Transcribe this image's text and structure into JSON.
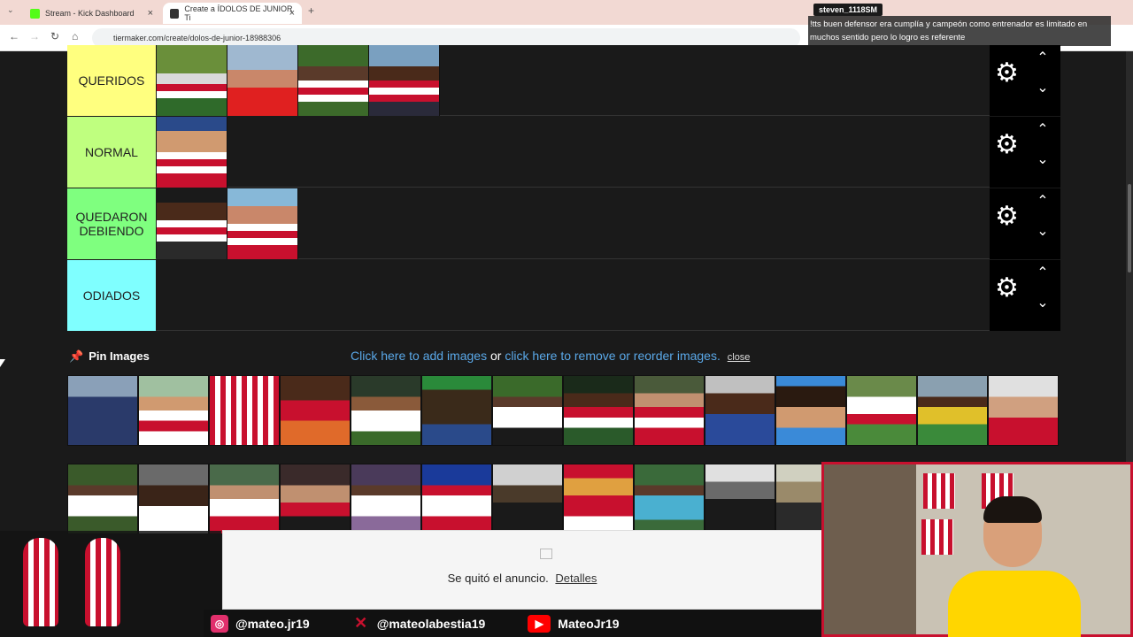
{
  "browser": {
    "tabs": [
      {
        "title": "Stream - Kick Dashboard",
        "favicon_color": "#53fc18"
      },
      {
        "title": "Create a ÍDOLOS DE JUNIOR Ti",
        "favicon_color": "#333333"
      }
    ],
    "new_tab": "+",
    "url": "tiermaker.com/create/dolos-de-junior-18988306"
  },
  "chat": {
    "username": "steven_1118SM",
    "message": "!tts buen defensor era cumplía y campeón como entrenador es limitado en muchos sentido pero lo logro es referente"
  },
  "tiers": [
    {
      "label": "QUERIDOS",
      "color": "#ffff7f",
      "items": 4
    },
    {
      "label": "NORMAL",
      "color": "#bfff7f",
      "items": 1
    },
    {
      "label": "QUEDARON DEBIENDO",
      "color": "#7fff7f",
      "items": 2
    },
    {
      "label": "ODIADOS",
      "color": "#7fffff",
      "items": 0
    }
  ],
  "pin_images": {
    "title": "Pin Images",
    "add_link": "Click here to add images",
    "or": " or ",
    "remove_link": "click here to remove or reorder images.",
    "close": "close"
  },
  "ad": {
    "text": "Se quitó el anuncio.",
    "details": "Detalles"
  },
  "socials": [
    {
      "platform": "instagram",
      "handle": "@mateo.jr19",
      "color": "#e1306c"
    },
    {
      "platform": "x",
      "handle": "@mateolabestia19",
      "color": "#c8102e"
    },
    {
      "platform": "youtube",
      "handle": "MateoJr19",
      "color": "#ff0000"
    }
  ]
}
